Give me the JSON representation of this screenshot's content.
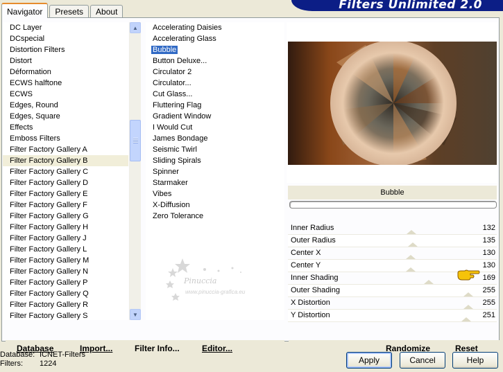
{
  "tabs": [
    {
      "label": "Navigator",
      "active": true
    },
    {
      "label": "Presets",
      "active": false
    },
    {
      "label": "About",
      "active": false
    }
  ],
  "banner": {
    "title": "Filters Unlimited 2.0"
  },
  "categories": [
    "DC Layer",
    "DCspecial",
    "Distortion Filters",
    "Distort",
    "Déformation",
    "ECWS halftone",
    "ECWS",
    "Edges, Round",
    "Edges, Square",
    "Effects",
    "Emboss Filters",
    "Filter Factory Gallery A",
    "Filter Factory Gallery B",
    "Filter Factory Gallery C",
    "Filter Factory Gallery D",
    "Filter Factory Gallery E",
    "Filter Factory Gallery F",
    "Filter Factory Gallery G",
    "Filter Factory Gallery H",
    "Filter Factory Gallery J",
    "Filter Factory Gallery L",
    "Filter Factory Gallery M",
    "Filter Factory Gallery N",
    "Filter Factory Gallery P",
    "Filter Factory Gallery Q",
    "Filter Factory Gallery R",
    "Filter Factory Gallery S"
  ],
  "highlighted_category": "Filter Factory Gallery B",
  "filters": [
    "Accelerating Daisies",
    "Accelerating Glass",
    "Bubble",
    "Button Deluxe...",
    "Circulator 2",
    "Circulator...",
    "Cut Glass...",
    "Fluttering Flag",
    "Gradient Window",
    "I Would Cut",
    "James Bondage",
    "Seismic Twirl",
    "Sliding Spirals",
    "Spinner",
    "Starmaker",
    "Vibes",
    "X-Diffusion",
    "Zero Tolerance"
  ],
  "selected_filter": "Bubble",
  "watermark": {
    "name": "Pinuccia",
    "url": "www.pinuccia-grafica.eu"
  },
  "effect_name": "Bubble",
  "params": [
    {
      "label": "Inner Radius",
      "value": 132
    },
    {
      "label": "Outer Radius",
      "value": 135
    },
    {
      "label": "Center X",
      "value": 130
    },
    {
      "label": "Center Y",
      "value": 130
    },
    {
      "label": "Inner Shading",
      "value": 169
    },
    {
      "label": "Outer Shading",
      "value": 255
    },
    {
      "label": "X Distortion",
      "value": 255
    },
    {
      "label": "Y Distortion",
      "value": 251
    }
  ],
  "bottom_left": {
    "database": "Database",
    "import": "Import...",
    "filter_info": "Filter Info...",
    "editor": "Editor..."
  },
  "bottom_right": {
    "randomize": "Randomize",
    "reset": "Reset"
  },
  "status": {
    "database_label": "Database:",
    "database_value": "ICNET-Filters",
    "filters_label": "Filters:",
    "filters_value": "1224"
  },
  "buttons": {
    "apply": "Apply",
    "cancel": "Cancel",
    "help": "Help"
  },
  "icons": {
    "scroll_up": "scroll-up-arrow-icon",
    "scroll_down": "scroll-down-arrow-icon",
    "pointer": "pointing-hand-icon"
  }
}
